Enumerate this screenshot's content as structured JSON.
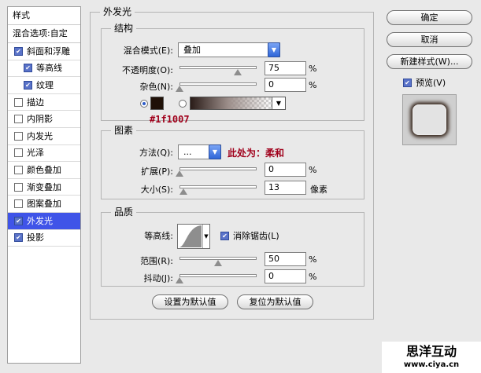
{
  "left_panel": {
    "title": "样式",
    "blend_options": "混合选项:自定",
    "items": [
      {
        "label": "斜面和浮雕",
        "checked": true,
        "sub": false,
        "selected": false
      },
      {
        "label": "等高线",
        "checked": true,
        "sub": true,
        "selected": false
      },
      {
        "label": "纹理",
        "checked": true,
        "sub": true,
        "selected": false
      },
      {
        "label": "描边",
        "checked": false,
        "sub": false,
        "selected": false
      },
      {
        "label": "内阴影",
        "checked": false,
        "sub": false,
        "selected": false
      },
      {
        "label": "内发光",
        "checked": false,
        "sub": false,
        "selected": false
      },
      {
        "label": "光泽",
        "checked": false,
        "sub": false,
        "selected": false
      },
      {
        "label": "颜色叠加",
        "checked": false,
        "sub": false,
        "selected": false
      },
      {
        "label": "渐变叠加",
        "checked": false,
        "sub": false,
        "selected": false
      },
      {
        "label": "图案叠加",
        "checked": false,
        "sub": false,
        "selected": false
      },
      {
        "label": "外发光",
        "checked": true,
        "sub": false,
        "selected": true
      },
      {
        "label": "投影",
        "checked": true,
        "sub": false,
        "selected": false
      }
    ]
  },
  "outer_glow": {
    "title": "外发光",
    "structure": {
      "title": "结构",
      "blend_mode_label": "混合模式(E):",
      "blend_mode_value": "叠加",
      "opacity_label": "不透明度(O):",
      "opacity_value": "75",
      "opacity_pct": 0.75,
      "noise_label": "杂色(N):",
      "noise_value": "0",
      "noise_pct": 0,
      "percent": "%",
      "color_hex": "#1f1007",
      "color_annotation": "#1f1007"
    },
    "elements": {
      "title": "图素",
      "method_label": "方法(Q):",
      "method_value": "...",
      "method_annotation": "此处为：柔和",
      "spread_label": "扩展(P):",
      "spread_value": "0",
      "spread_pct": 0,
      "size_label": "大小(S):",
      "size_value": "13",
      "size_pct": 0.05,
      "percent": "%",
      "pixels": "像素"
    },
    "quality": {
      "title": "品质",
      "contour_label": "等高线:",
      "antialias_label": "消除锯齿(L)",
      "antialias_checked": true,
      "range_label": "范围(R):",
      "range_value": "50",
      "range_pct": 0.5,
      "jitter_label": "抖动(J):",
      "jitter_value": "0",
      "jitter_pct": 0,
      "percent": "%"
    },
    "make_default": "设置为默认值",
    "reset_default": "复位为默认值"
  },
  "buttons": {
    "ok": "确定",
    "cancel": "取消",
    "new_style": "新建样式(W)...",
    "preview_label": "预览(V)",
    "preview_checked": true
  },
  "watermark": {
    "line1": "思洋互动",
    "line2": "www.ciya.cn"
  }
}
